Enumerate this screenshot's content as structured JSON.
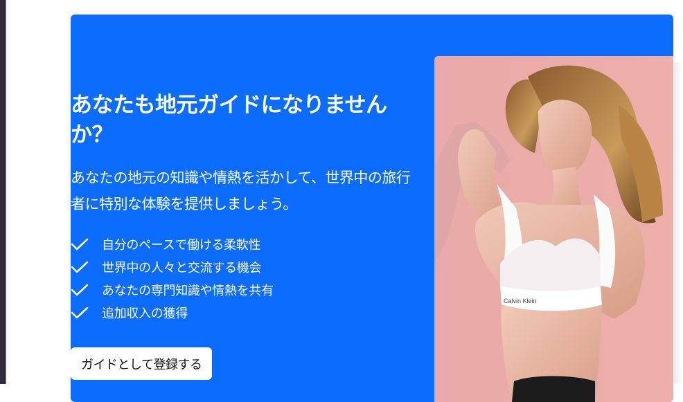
{
  "hero": {
    "title": "あなたも地元ガイドになりませんか？",
    "description": "あなたの地元の知識や情熱を活かして、世界中の旅行者に特別な体験を提供しましょう。",
    "benefits": [
      {
        "icon": "check-icon",
        "label": "自分のペースで働ける柔軟性"
      },
      {
        "icon": "check-icon",
        "label": "世界中の人々と交流する機会"
      },
      {
        "icon": "check-icon",
        "label": "あなたの専門知識や情熱を共有"
      },
      {
        "icon": "check-icon",
        "label": "追加収入の獲得"
      }
    ],
    "cta_label": "ガイドとして登録する",
    "photo_caption": "Calvin Klein"
  },
  "colors": {
    "hero_background": "#0b6cff",
    "text": "#ffffff",
    "button_background": "#ffffff",
    "button_text": "#111111",
    "photo_background": "#e7a7a4"
  }
}
